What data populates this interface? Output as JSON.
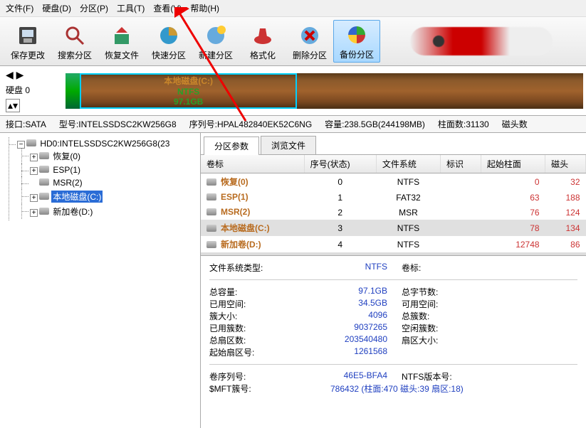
{
  "menu": [
    "文件(F)",
    "硬盘(D)",
    "分区(P)",
    "工具(T)",
    "查看(V)",
    "帮助(H)"
  ],
  "toolbar": [
    {
      "name": "save",
      "label": "保存更改"
    },
    {
      "name": "search",
      "label": "搜索分区"
    },
    {
      "name": "recover",
      "label": "恢复文件"
    },
    {
      "name": "quick",
      "label": "快速分区"
    },
    {
      "name": "new",
      "label": "新建分区"
    },
    {
      "name": "format",
      "label": "格式化"
    },
    {
      "name": "delete",
      "label": "删除分区"
    },
    {
      "name": "backup",
      "label": "备份分区",
      "selected": true
    }
  ],
  "diskbar_left_label": "硬盘 0",
  "sel_part": {
    "line1": "本地磁盘(C:)",
    "line2": "NTFS",
    "line3": "97.1GB"
  },
  "info": {
    "port": "接口:SATA",
    "model": "型号:INTELSSDSC2KW256G8",
    "serial": "序列号:HPAL482840EK52C6NG",
    "capacity": "容量:238.5GB(244198MB)",
    "cyl": "柱面数:31130",
    "heads": "磁头数"
  },
  "tree": {
    "root": "HD0:INTELSSDSC2KW256G8(23",
    "items": [
      {
        "label": "恢复(0)",
        "expandable": true
      },
      {
        "label": "ESP(1)",
        "expandable": true
      },
      {
        "label": "MSR(2)",
        "expandable": false
      },
      {
        "label": "本地磁盘(C:)",
        "expandable": true,
        "selected": true
      },
      {
        "label": "新加卷(D:)",
        "expandable": true
      }
    ]
  },
  "tabs": [
    "分区参数",
    "浏览文件"
  ],
  "grid": {
    "headers": [
      "卷标",
      "序号(状态)",
      "文件系统",
      "标识",
      "起始柱面",
      "磁头"
    ],
    "rows": [
      {
        "vol": "恢复(0)",
        "idx": "0",
        "fs": "NTFS",
        "flag": "",
        "cyl": "0",
        "head": "32"
      },
      {
        "vol": "ESP(1)",
        "idx": "1",
        "fs": "FAT32",
        "flag": "",
        "cyl": "63",
        "head": "188"
      },
      {
        "vol": "MSR(2)",
        "idx": "2",
        "fs": "MSR",
        "flag": "",
        "cyl": "76",
        "head": "124"
      },
      {
        "vol": "本地磁盘(C:)",
        "idx": "3",
        "fs": "NTFS",
        "flag": "",
        "cyl": "78",
        "head": "134",
        "sel": true
      },
      {
        "vol": "新加卷(D:)",
        "idx": "4",
        "fs": "NTFS",
        "flag": "",
        "cyl": "12748",
        "head": "86"
      }
    ]
  },
  "detail": {
    "fstype_k": "文件系统类型:",
    "fstype_v": "NTFS",
    "label_k": "卷标:",
    "rows": [
      {
        "k": "总容量:",
        "v": "97.1GB",
        "k2": "总字节数:"
      },
      {
        "k": "已用空间:",
        "v": "34.5GB",
        "k2": "可用空间:"
      },
      {
        "k": "簇大小:",
        "v": "4096",
        "k2": "总簇数:"
      },
      {
        "k": "已用簇数:",
        "v": "9037265",
        "k2": "空闲簇数:"
      },
      {
        "k": "总扇区数:",
        "v": "203540480",
        "k2": "扇区大小:"
      },
      {
        "k": "起始扇区号:",
        "v": "1261568",
        "k2": ""
      }
    ],
    "serial_k": "卷序列号:",
    "serial_v": "46E5-BFA4",
    "ntfsver_k": "NTFS版本号:",
    "mft_k": "$MFT簇号:",
    "mft_v": "786432 (柱面:470 磁头:39 扇区:18)"
  }
}
